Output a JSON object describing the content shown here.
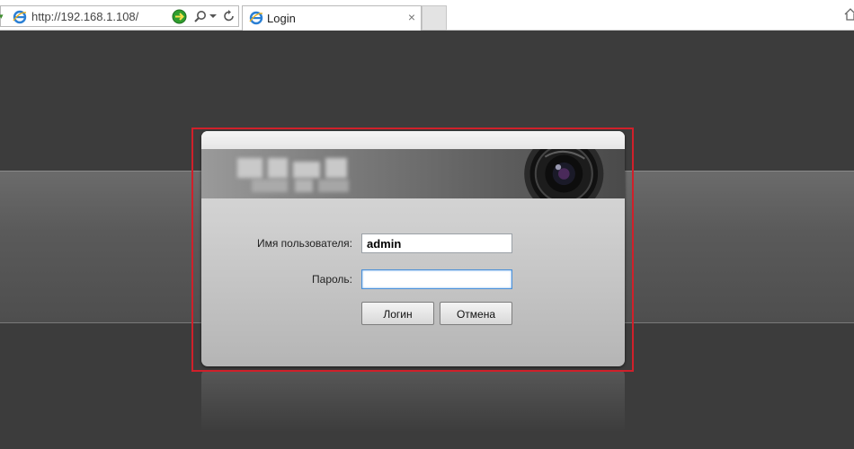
{
  "browser": {
    "address_url": "http://192.168.1.108/",
    "tab_title": "Login",
    "tab_close": "×"
  },
  "login": {
    "username_label": "Имя пользователя:",
    "username_value": "admin",
    "password_label": "Пароль:",
    "password_value": "",
    "login_button": "Логин",
    "cancel_button": "Отмена"
  },
  "colors": {
    "highlight_frame": "#d0202a",
    "focus_border": "#4a90d9"
  },
  "icons": {
    "address_site_icon": "ie-icon",
    "go": "green-go-icon",
    "search": "search-icon",
    "refresh": "refresh-icon",
    "home": "home-icon"
  }
}
